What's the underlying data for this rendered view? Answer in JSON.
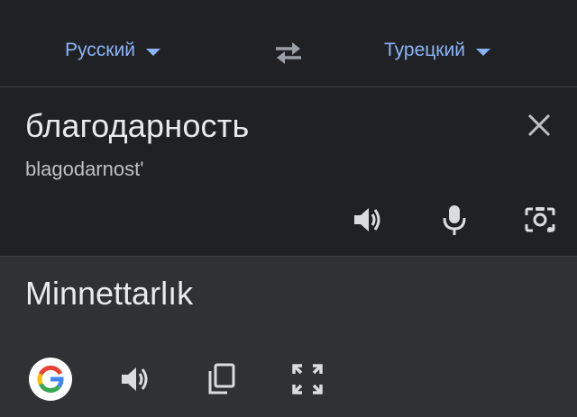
{
  "language_bar": {
    "source_language": "Русский",
    "target_language": "Турецкий"
  },
  "input": {
    "source_text": "благодарность",
    "transliteration": "blagodarnost'"
  },
  "output": {
    "translated_text": "Minnettarlık"
  },
  "icons": {
    "swap": "swap-arrows-icon",
    "clear": "close-icon",
    "listen_source": "speaker-icon",
    "voice_input": "microphone-icon",
    "camera_input": "camera-icon",
    "google": "google-logo-icon",
    "listen_translation": "speaker-icon",
    "copy": "copy-icon",
    "fullscreen": "fullscreen-icon"
  },
  "colors": {
    "background": "#202124",
    "output_background": "#303134",
    "accent": "#8ab4f8",
    "text_primary": "#e8eaed",
    "text_secondary": "#bdc1c6",
    "icon": "#dadce0",
    "divider": "#3c4043"
  }
}
